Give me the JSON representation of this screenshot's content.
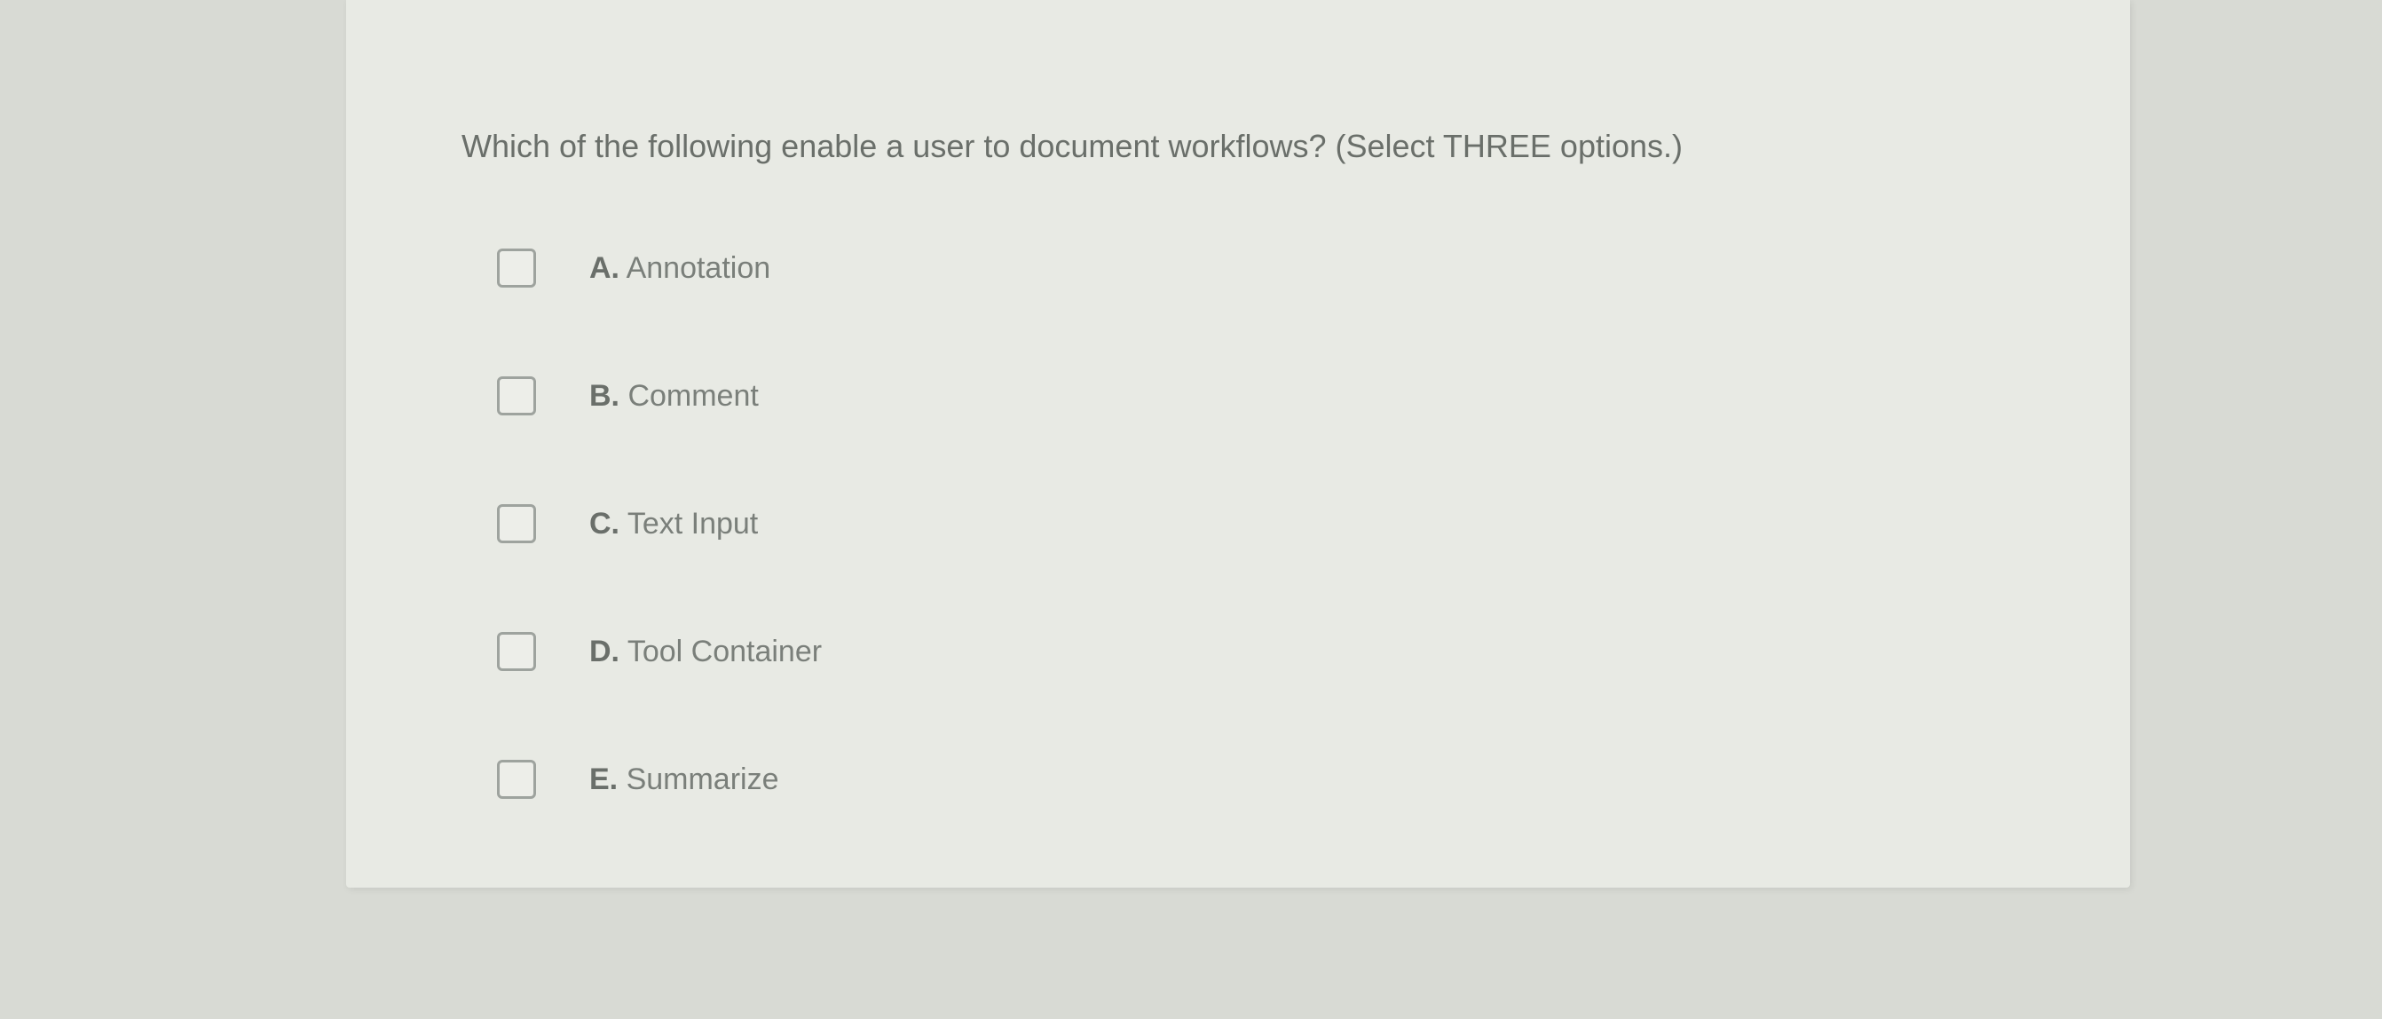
{
  "question": {
    "text": "Which of the following enable a user to document workflows? (Select THREE options.)"
  },
  "options": [
    {
      "letter": "A.",
      "text": " Annotation"
    },
    {
      "letter": "B.",
      "text": " Comment"
    },
    {
      "letter": "C.",
      "text": " Text Input"
    },
    {
      "letter": "D.",
      "text": " Tool Container"
    },
    {
      "letter": "E.",
      "text": " Summarize"
    }
  ]
}
